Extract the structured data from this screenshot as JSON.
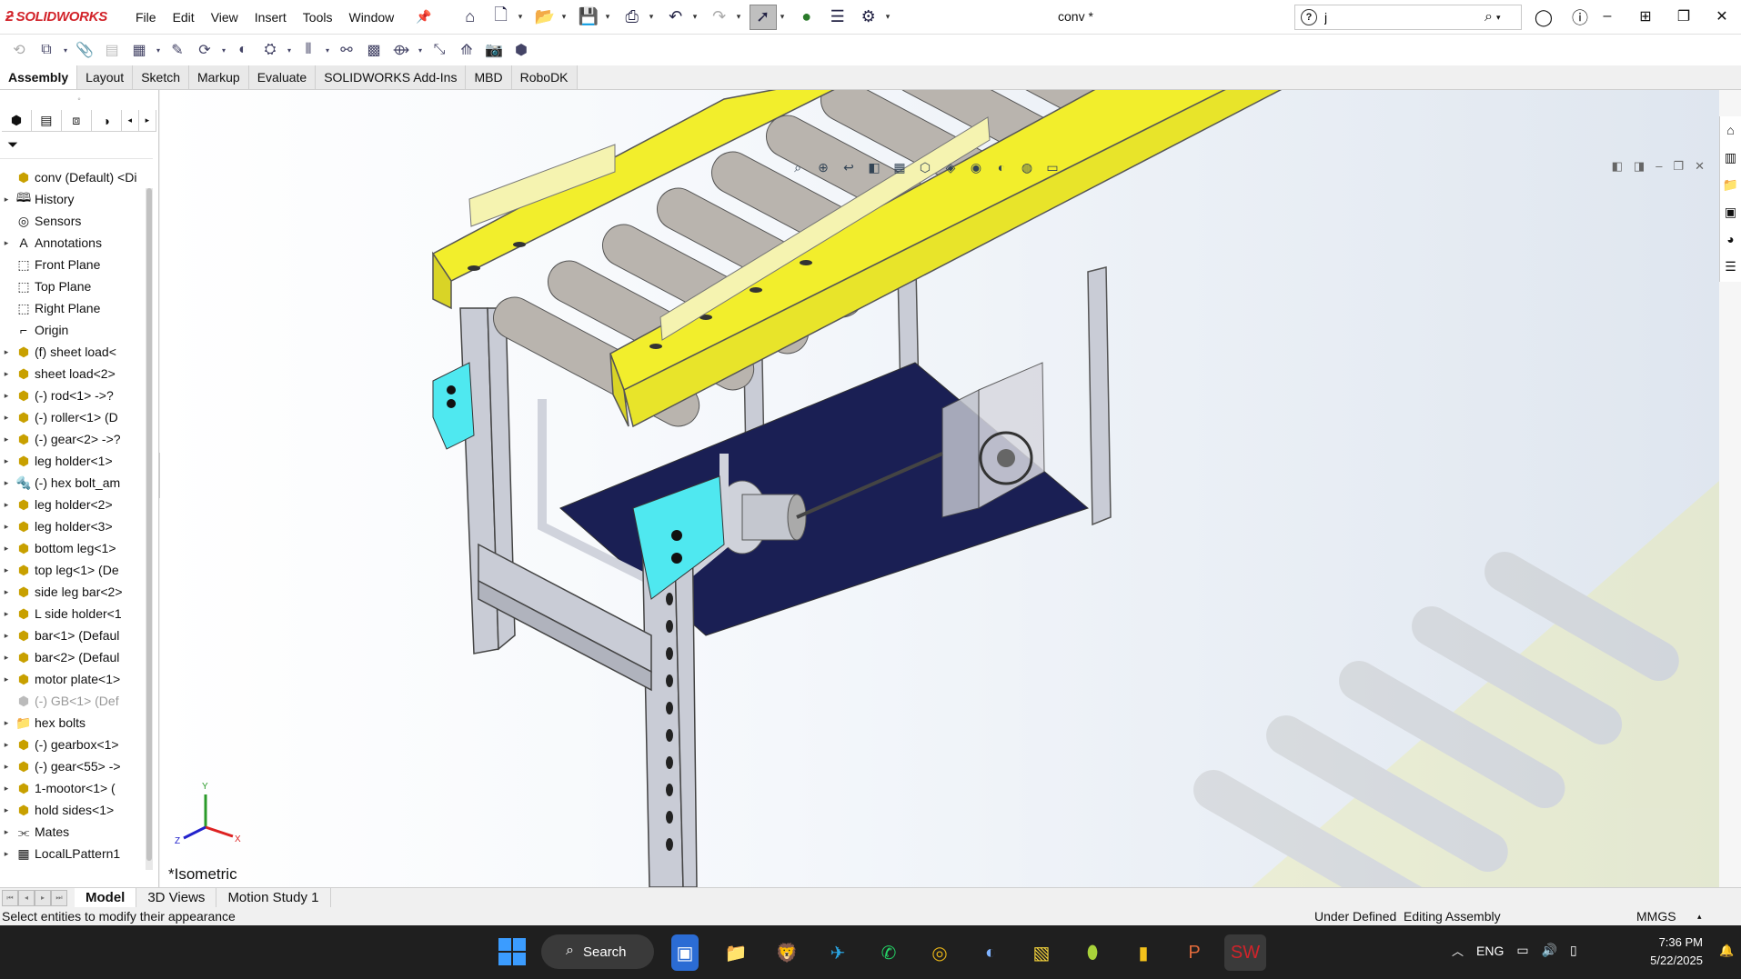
{
  "app": {
    "brand": "SOLIDWORKS",
    "doc_title": "conv *",
    "menus": [
      "File",
      "Edit",
      "View",
      "Insert",
      "Tools",
      "Window"
    ],
    "search": {
      "value": "j",
      "placeholder": ""
    }
  },
  "ribbon_tabs": [
    "Assembly",
    "Layout",
    "Sketch",
    "Markup",
    "Evaluate",
    "SOLIDWORKS Add-Ins",
    "MBD",
    "RoboDK"
  ],
  "active_ribbon_tab": "Assembly",
  "feature_tree": {
    "root": "conv (Default) <Di",
    "items": [
      {
        "label": "History",
        "icon": "history-icon",
        "expandable": true,
        "dim": false
      },
      {
        "label": "Sensors",
        "icon": "sensor-icon",
        "expandable": false,
        "dim": false
      },
      {
        "label": "Annotations",
        "icon": "annotation-icon",
        "expandable": true,
        "dim": false
      },
      {
        "label": "Front Plane",
        "icon": "plane-icon",
        "expandable": false,
        "dim": false
      },
      {
        "label": "Top Plane",
        "icon": "plane-icon",
        "expandable": false,
        "dim": false
      },
      {
        "label": "Right Plane",
        "icon": "plane-icon",
        "expandable": false,
        "dim": false
      },
      {
        "label": "Origin",
        "icon": "origin-icon",
        "expandable": false,
        "dim": false
      },
      {
        "label": "(f) sheet load<",
        "icon": "part-icon",
        "expandable": true,
        "dim": false
      },
      {
        "label": "sheet load<2>",
        "icon": "part-icon",
        "expandable": true,
        "dim": false
      },
      {
        "label": "(-) rod<1> ->?",
        "icon": "part-icon",
        "expandable": true,
        "dim": false
      },
      {
        "label": "(-) roller<1> (D",
        "icon": "part-icon",
        "expandable": true,
        "dim": false
      },
      {
        "label": "(-) gear<2> ->?",
        "icon": "part-icon",
        "expandable": true,
        "dim": false
      },
      {
        "label": "leg holder<1>",
        "icon": "part-icon",
        "expandable": true,
        "dim": false
      },
      {
        "label": "(-) hex bolt_am",
        "icon": "bolt-icon",
        "expandable": true,
        "dim": false
      },
      {
        "label": "leg holder<2>",
        "icon": "part-icon",
        "expandable": true,
        "dim": false
      },
      {
        "label": "leg holder<3>",
        "icon": "part-icon",
        "expandable": true,
        "dim": false
      },
      {
        "label": "bottom leg<1>",
        "icon": "part-icon",
        "expandable": true,
        "dim": false
      },
      {
        "label": "top leg<1> (De",
        "icon": "part-icon",
        "expandable": true,
        "dim": false
      },
      {
        "label": "side leg bar<2>",
        "icon": "part-icon",
        "expandable": true,
        "dim": false
      },
      {
        "label": "L side holder<1",
        "icon": "part-icon",
        "expandable": true,
        "dim": false
      },
      {
        "label": "bar<1> (Defaul",
        "icon": "part-icon",
        "expandable": true,
        "dim": false
      },
      {
        "label": "bar<2> (Defaul",
        "icon": "part-icon",
        "expandable": true,
        "dim": false
      },
      {
        "label": "motor plate<1>",
        "icon": "part-icon",
        "expandable": true,
        "dim": false
      },
      {
        "label": "(-) GB<1> (Def",
        "icon": "part-icon",
        "expandable": false,
        "dim": true
      },
      {
        "label": "hex bolts",
        "icon": "folder-icon",
        "expandable": true,
        "dim": false
      },
      {
        "label": "(-) gearbox<1>",
        "icon": "subassembly-icon",
        "expandable": true,
        "dim": false
      },
      {
        "label": "(-) gear<55> ->",
        "icon": "part-icon",
        "expandable": true,
        "dim": false
      },
      {
        "label": "1-mootor<1> (",
        "icon": "part-icon",
        "expandable": true,
        "dim": false
      },
      {
        "label": "hold sides<1>",
        "icon": "part-icon",
        "expandable": true,
        "dim": false
      },
      {
        "label": "Mates",
        "icon": "mates-icon",
        "expandable": true,
        "dim": false
      },
      {
        "label": "LocalLPattern1",
        "icon": "pattern-icon",
        "expandable": true,
        "dim": false
      }
    ]
  },
  "viewport": {
    "view_label": "*Isometric",
    "triad": {
      "y": "Y",
      "x": "X",
      "z": "Z"
    }
  },
  "bottom_tabs": [
    "Model",
    "3D Views",
    "Motion Study 1"
  ],
  "active_bottom_tab": "Model",
  "status": {
    "message": "Select entities to modify their appearance",
    "definition": "Under Defined",
    "mode": "Editing Assembly",
    "units": "MMGS"
  },
  "taskbar": {
    "search_label": "Search",
    "language": "ENG",
    "time": "7:36 PM",
    "date": "5/22/2025"
  },
  "colors": {
    "frame_yellow": "#f2ee2c",
    "leg_gray": "#c9ccd6",
    "bracket_cyan": "#4fe8f0",
    "plate_navy": "#1a1f54",
    "roller_gray": "#b9b4ae",
    "brand_red": "#d2232a"
  }
}
